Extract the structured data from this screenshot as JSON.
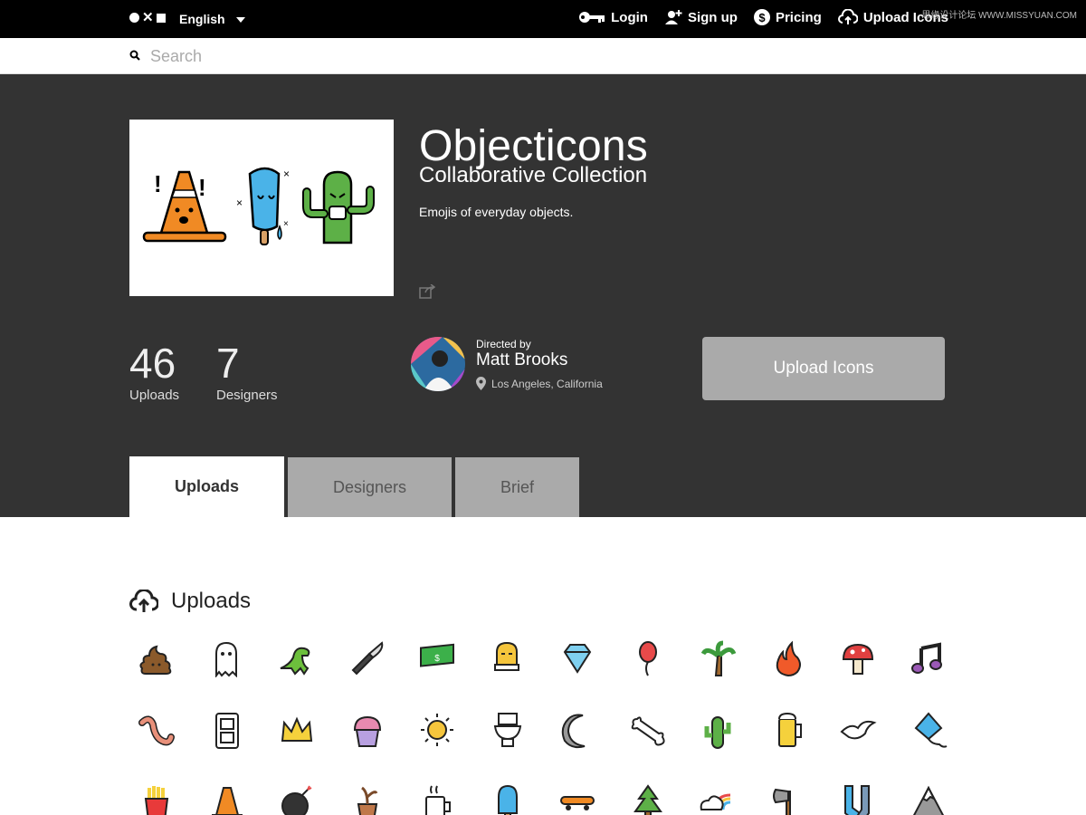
{
  "topbar": {
    "language": "English",
    "nav": [
      {
        "label": "Login",
        "icon": "key-icon"
      },
      {
        "label": "Sign up",
        "icon": "add-user-icon"
      },
      {
        "label": "Pricing",
        "icon": "dollar-icon"
      },
      {
        "label": "Upload Icons",
        "icon": "cloud-upload-icon"
      }
    ],
    "watermark": "思缘设计论坛 WWW.MISSYUAN.COM"
  },
  "search": {
    "placeholder": "Search"
  },
  "collection": {
    "title": "Objecticons",
    "subtitle": "Collaborative Collection",
    "description": "Emojis of everyday objects.",
    "stats": {
      "uploads_count": "46",
      "uploads_label": "Uploads",
      "designers_count": "7",
      "designers_label": "Designers"
    },
    "director": {
      "directed_by": "Directed by",
      "name": "Matt Brooks",
      "location": "Los Angeles, California"
    },
    "upload_button": "Upload Icons"
  },
  "tabs": [
    {
      "label": "Uploads",
      "active": true
    },
    {
      "label": "Designers",
      "active": false
    },
    {
      "label": "Brief",
      "active": false
    }
  ],
  "uploads_section": {
    "title": "Uploads"
  },
  "icons": [
    "poop-icon",
    "ghost-icon",
    "dinosaur-icon",
    "knife-icon",
    "money-icon",
    "toast-icon",
    "diamond-icon",
    "balloon-icon",
    "palm-tree-icon",
    "fire-icon",
    "mushroom-icon",
    "music-note-icon",
    "worm-icon",
    "outlet-icon",
    "crown-icon",
    "cupcake-icon",
    "sun-icon",
    "toilet-icon",
    "moon-icon",
    "bone-icon",
    "cactus-icon",
    "beer-icon",
    "bird-icon",
    "kite-icon",
    "fries-icon",
    "cone-icon",
    "bomb-icon",
    "plant-icon",
    "coffee-mug-icon",
    "popsicle-icon",
    "skateboard-icon",
    "pine-tree-icon",
    "rainbow-cloud-icon",
    "axe-icon",
    "socks-icon",
    "mountain-icon"
  ],
  "colors": {
    "topbar": "#000000",
    "hero": "#333333",
    "button_gray": "#aaaaaa"
  }
}
